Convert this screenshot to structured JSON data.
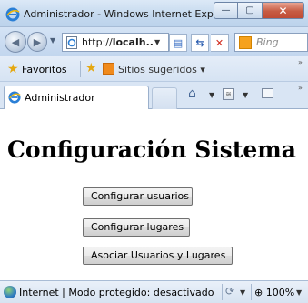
{
  "window": {
    "title": "Administrador - Windows Internet Explorer",
    "controls": {
      "minimize": "—",
      "maximize": "▢",
      "close": "✕"
    }
  },
  "navbar": {
    "address": {
      "prefix": "http://",
      "host": "localh...",
      "dropdown": "▼"
    },
    "search": {
      "placeholder": "Bing"
    }
  },
  "favorites": {
    "label": "Favoritos",
    "suggested_sites": "Sitios sugeridos ▾",
    "more": "»"
  },
  "tabs": {
    "active": {
      "label": "Administrador"
    },
    "more": "»"
  },
  "page": {
    "title": "Configuración Sistema",
    "buttons": [
      {
        "label": "Configurar usuarios"
      },
      {
        "label": "Configurar lugares"
      },
      {
        "label": "Asociar Usuarios y Lugares"
      }
    ]
  },
  "statusbar": {
    "text": "Internet | Modo protegido: desactivado",
    "zoom": "100%"
  },
  "icons": {
    "ie": "ie-logo-icon",
    "back": "back-arrow-icon",
    "forward": "forward-arrow-icon",
    "compat": "compatibility-view-icon",
    "refresh": "refresh-icon",
    "stop": "stop-icon",
    "bing": "bing-icon",
    "star": "favorites-star-icon",
    "add_fav": "add-favorite-icon",
    "home": "home-icon",
    "feed": "feeds-icon",
    "mail": "mail-icon",
    "globe": "internet-zone-icon",
    "zoom": "zoom-icon"
  },
  "colors": {
    "chrome": "#c4d8ee",
    "close_button": "#c75b43",
    "button_face": "#e5e5e5",
    "button_border": "#707070"
  }
}
